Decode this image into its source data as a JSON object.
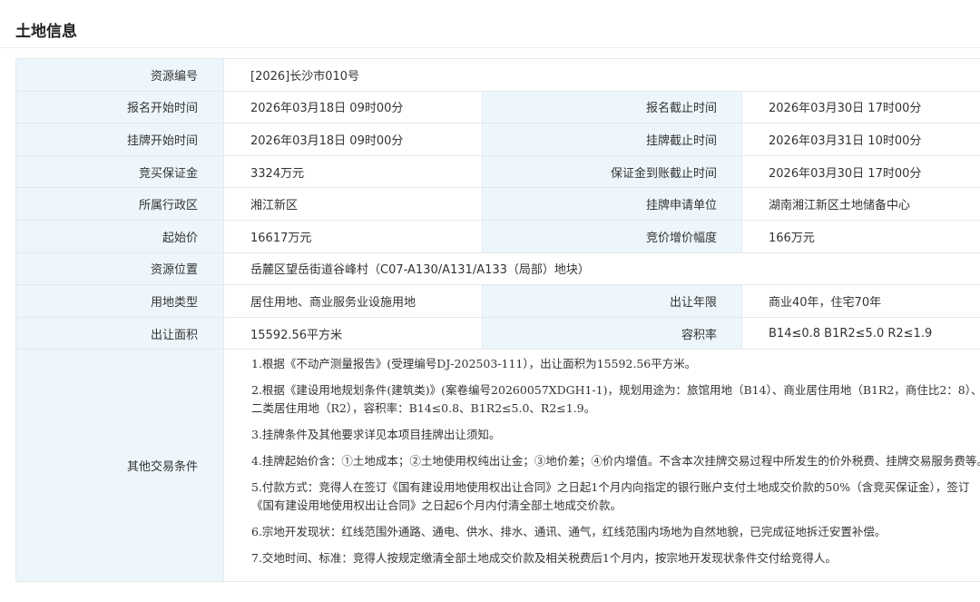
{
  "page_title": "土地信息",
  "rows": {
    "resource_no": {
      "label": "资源编号",
      "value": "[2026]长沙市010号"
    },
    "signup_start": {
      "label": "报名开始时间",
      "value": "2026年03月18日 09时00分"
    },
    "signup_end": {
      "label": "报名截止时间",
      "value": "2026年03月30日 17时00分"
    },
    "listing_start": {
      "label": "挂牌开始时间",
      "value": "2026年03月18日 09时00分"
    },
    "listing_end": {
      "label": "挂牌截止时间",
      "value": "2026年03月31日 10时00分"
    },
    "deposit": {
      "label": "竞买保证金",
      "value": "3324万元"
    },
    "deposit_deadline": {
      "label": "保证金到账截止时间",
      "value": "2026年03月30日 17时00分"
    },
    "district": {
      "label": "所属行政区",
      "value": "湘江新区"
    },
    "applicant": {
      "label": "挂牌申请单位",
      "value": "湖南湘江新区土地储备中心"
    },
    "start_price": {
      "label": "起始价",
      "value": "16617万元"
    },
    "increment": {
      "label": "竞价增价幅度",
      "value": "166万元"
    },
    "location": {
      "label": "资源位置",
      "value": "岳麓区望岳街道谷峰村（C07-A130/A131/A133（局部）地块）"
    },
    "land_use": {
      "label": "用地类型",
      "value": "居住用地、商业服务业设施用地"
    },
    "term": {
      "label": "出让年限",
      "value": "商业40年，住宅70年"
    },
    "area": {
      "label": "出让面积",
      "value": "15592.56平方米"
    },
    "far": {
      "label": "容积率",
      "value": "B14≤0.8 B1R2≤5.0 R2≤1.9"
    }
  },
  "conditions": {
    "label": "其他交易条件",
    "items": [
      "1.根据《不动产测量报告》(受理编号DJ-202503-111），出让面积为15592.56平方米。",
      "2.根据《建设用地规划条件(建筑类)》(案卷编号20260057XDGH1-1)，规划用途为：旅馆用地（B14）、商业居住用地（B1R2，商住比2：8）、二类居住用地（R2），容积率：B14≤0.8、B1R2≤5.0、R2≤1.9。",
      "3.挂牌条件及其他要求详见本项目挂牌出让须知。",
      "4.挂牌起始价含：①土地成本；②土地使用权纯出让金；③地价差；④价内增值。不含本次挂牌交易过程中所发生的价外税费、挂牌交易服务费等。",
      "5.付款方式：竞得人在签订《国有建设用地使用权出让合同》之日起1个月内向指定的银行账户支付土地成交价款的50%（含竞买保证金），签订《国有建设用地使用权出让合同》之日起6个月内付清全部土地成交价款。",
      "6.宗地开发现状：红线范围外通路、通电、供水、排水、通讯、通气，红线范围内场地为自然地貌，已完成征地拆迁安置补偿。",
      "7.交地时间、标准：竞得人按规定缴清全部土地成交价款及相关税费后1个月内，按宗地开发现状条件交付给竞得人。"
    ]
  }
}
